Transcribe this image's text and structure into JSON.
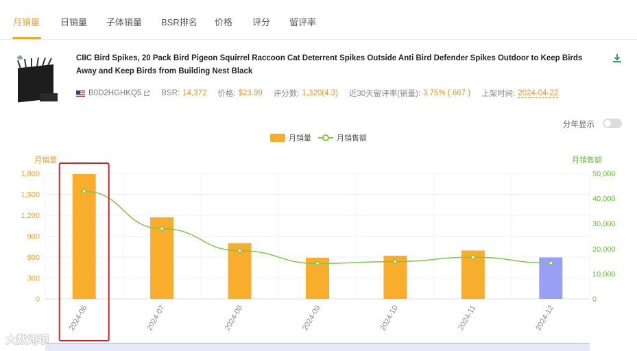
{
  "tabs": [
    {
      "label": "月销量",
      "active": true
    },
    {
      "label": "日销量"
    },
    {
      "label": "子体销量"
    },
    {
      "label": "BSR排名"
    },
    {
      "label": "价格"
    },
    {
      "label": "评分"
    },
    {
      "label": "留评率"
    }
  ],
  "product": {
    "title": "CIIC Bird Spikes, 20 Pack Bird Pigeon Squirrel Raccoon Cat Deterrent Spikes Outside Anti Bird Defender Spikes Outdoor to Keep Birds Away and Keep Birds from Building Nest Black",
    "asin": "B0D2HGHKQ5",
    "bsr_label": "BSR:",
    "bsr_value": "14,372",
    "price_label": "价格:",
    "price_value": "$23.99",
    "reviews_label": "评分数:",
    "reviews_value": "1,320(4.3)",
    "review_rate_label": "近30天留评率(销量):",
    "review_rate_value": "3.75% ( 667 )",
    "listed_label": "上架时间:",
    "listed_value": "2024-04-22"
  },
  "controls": {
    "year_toggle_label": "分年显示",
    "year_toggle_on": false
  },
  "watermark": "大数跨境",
  "colors": {
    "accent": "#f5a623",
    "bar": "#f9ad2c",
    "bar_highlight": "#98a0f6",
    "line": "#7ac943",
    "highlight_box": "#d0202a"
  },
  "icons": [
    "download-icon",
    "us-flag-icon",
    "external-link-icon"
  ],
  "chart_data": {
    "type": "bar",
    "categories": [
      "2024-06",
      "2024-07",
      "2024-08",
      "2024-09",
      "2024-10",
      "2024-11",
      "2024-12"
    ],
    "series": [
      {
        "name": "月销量",
        "type": "bar",
        "axis": "left",
        "values": [
          1790,
          1170,
          800,
          590,
          620,
          695,
          595
        ]
      },
      {
        "name": "月销售额",
        "type": "line",
        "axis": "right",
        "values": [
          42900,
          28000,
          19200,
          14100,
          14900,
          16600,
          14300
        ]
      }
    ],
    "ylabel": "月销量",
    "ylabel_right": "月销售额",
    "ylim": [
      0,
      1800
    ],
    "ylim_right": [
      0,
      50000
    ],
    "yticks": [
      "0",
      "300",
      "600",
      "900",
      "1,200",
      "1,500",
      "1,800"
    ],
    "yticks_right": [
      "0",
      "10,000",
      "20,000",
      "30,000",
      "40,000",
      "50,000"
    ],
    "highlighted_category": "2024-06",
    "highlighted_bar_colour_category": "2024-12",
    "grid": true,
    "legend_position": "top-center"
  }
}
